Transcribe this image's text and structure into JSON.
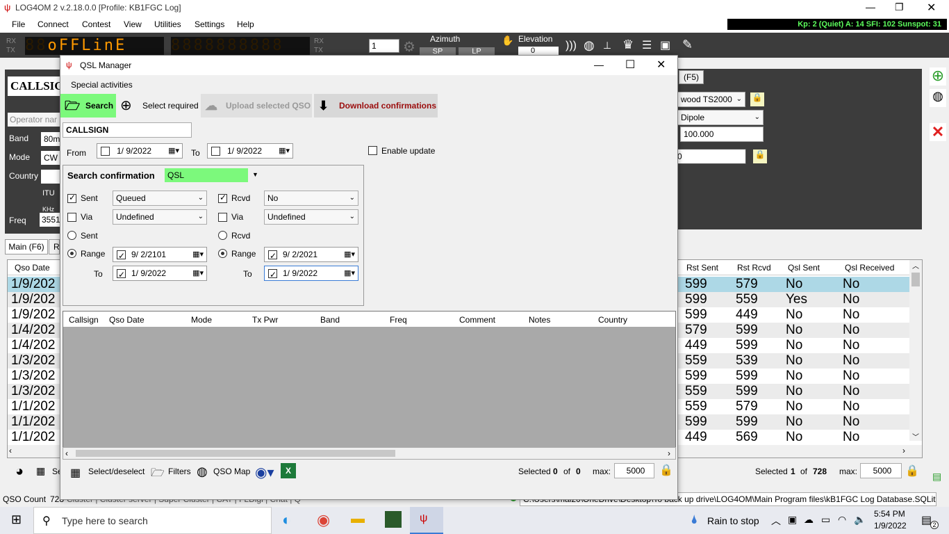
{
  "app": {
    "title": "LOG4OM 2 v.2.18.0.0 [Profile: KB1FGC Log]",
    "menu": [
      "File",
      "Connect",
      "Contest",
      "View",
      "Utilities",
      "Settings",
      "Help"
    ],
    "kp_status": "Kp: 2 (Quiet)  A: 14  SFI: 102 Sunspot: 31",
    "led_text": "oFFLinE",
    "step_value": "1",
    "azimuth_label": "Azimuth",
    "elevation_label": "Elevation",
    "sp_label": "SP",
    "lp_label": "LP",
    "elevation_value": "0",
    "callsign_label": "CALLSIGN",
    "operator_placeholder": "Operator nar",
    "band_label": "Band",
    "band_value": "80m",
    "mode_label": "Mode",
    "mode_value": "CW",
    "country_label": "Country",
    "itu_label": "ITU",
    "khz_label": "KHz",
    "freq_label": "Freq",
    "freq_value": "3551",
    "f5_label": "(F5)",
    "radio_value": "wood TS2000",
    "antenna_value": "Dipole",
    "power_value": "100.000",
    "zero_value": "0",
    "main_tab": "Main (F6)",
    "r_tab": "R",
    "qso_date_header": "Qso Date",
    "table_headers": {
      "rst_sent": "Rst Sent",
      "rst_rcvd": "Rst Rcvd",
      "qsl_sent": "Qsl Sent",
      "qsl_received": "Qsl Received"
    },
    "rows": [
      {
        "date": "1/9/202",
        "rst_sent": "599",
        "rst_rcvd": "579",
        "qsl_sent": "No",
        "qsl_received": "No"
      },
      {
        "date": "1/9/202",
        "rst_sent": "599",
        "rst_rcvd": "559",
        "qsl_sent": "Yes",
        "qsl_received": "No"
      },
      {
        "date": "1/9/202",
        "rst_sent": "599",
        "rst_rcvd": "449",
        "qsl_sent": "No",
        "qsl_received": "No"
      },
      {
        "date": "1/4/202",
        "rst_sent": "579",
        "rst_rcvd": "599",
        "qsl_sent": "No",
        "qsl_received": "No"
      },
      {
        "date": "1/4/202",
        "rst_sent": "449",
        "rst_rcvd": "599",
        "qsl_sent": "No",
        "qsl_received": "No"
      },
      {
        "date": "1/3/202",
        "rst_sent": "559",
        "rst_rcvd": "539",
        "qsl_sent": "No",
        "qsl_received": "No"
      },
      {
        "date": "1/3/202",
        "rst_sent": "599",
        "rst_rcvd": "599",
        "qsl_sent": "No",
        "qsl_received": "No"
      },
      {
        "date": "1/3/202",
        "rst_sent": "559",
        "rst_rcvd": "599",
        "qsl_sent": "No",
        "qsl_received": "No"
      },
      {
        "date": "1/1/202",
        "rst_sent": "559",
        "rst_rcvd": "579",
        "qsl_sent": "No",
        "qsl_received": "No"
      },
      {
        "date": "1/1/202",
        "rst_sent": "599",
        "rst_rcvd": "599",
        "qsl_sent": "No",
        "qsl_received": "No"
      },
      {
        "date": "1/1/202",
        "rst_sent": "449",
        "rst_rcvd": "569",
        "qsl_sent": "No",
        "qsl_received": "No"
      }
    ],
    "selected_label": "Selected",
    "selected_count": "1",
    "of_label": "of",
    "total_count": "728",
    "max_label": "max:",
    "max_value": "5000",
    "se_label": "Se",
    "qso_count_label": "QSO Count",
    "qso_count_value": "728",
    "status_tabs": "Cluster | Cluster server | Super Cluster | CAT | FLDigi | Chat | Q",
    "db_path": "C:\\Users\\mal20\\OneDrive\\Desktop\\To back up drive\\LOG4OM\\Main Program files\\kB1FGC Log Database.SQLite"
  },
  "dialog": {
    "title": "QSL Manager",
    "special_activities": "Special activities",
    "search_btn": "Search",
    "select_required_btn": "Select required",
    "upload_btn": "Upload selected QSO",
    "download_btn": "Download confirmations",
    "callsign_value": "CALLSIGN",
    "from_label": "From",
    "from_date": "1/ 9/2022",
    "to_label": "To",
    "to_date": "1/ 9/2022",
    "enable_update": "Enable update",
    "search_confirmation_label": "Search confirmation",
    "search_confirmation_value": "QSL",
    "sent_label": "Sent",
    "sent_value": "Queued",
    "rcvd_label": "Rcvd",
    "rcvd_value": "No",
    "via_label": "Via",
    "via_value": "Undefined",
    "rcvd_via_value": "Undefined",
    "range_label": "Range",
    "sent_range_from": "9/ 2/2101",
    "sent_range_to": "1/ 9/2022",
    "rcvd_range_from": "9/ 2/2021",
    "rcvd_range_to": "1/ 9/2022",
    "to_lbl": "To",
    "columns": [
      "Callsign",
      "Qso Date",
      "Mode",
      "Tx Pwr",
      "Band",
      "Freq",
      "Comment",
      "Notes",
      "Country"
    ],
    "select_deselect": "Select/deselect",
    "filters": "Filters",
    "qso_map": "QSO Map",
    "selected_label": "Selected",
    "selected_count": "0",
    "of_label": "of",
    "total_count": "0",
    "max_label": "max:",
    "max_value": "5000"
  },
  "taskbar": {
    "search_placeholder": "Type here to search",
    "weather": "Rain to stop",
    "time": "5:54 PM",
    "date": "1/9/2022",
    "notif_count": "2"
  },
  "colors": {
    "search_green": "#7cf97c",
    "download_red": "#9b0d0d",
    "selected_row": "#add8e6"
  }
}
